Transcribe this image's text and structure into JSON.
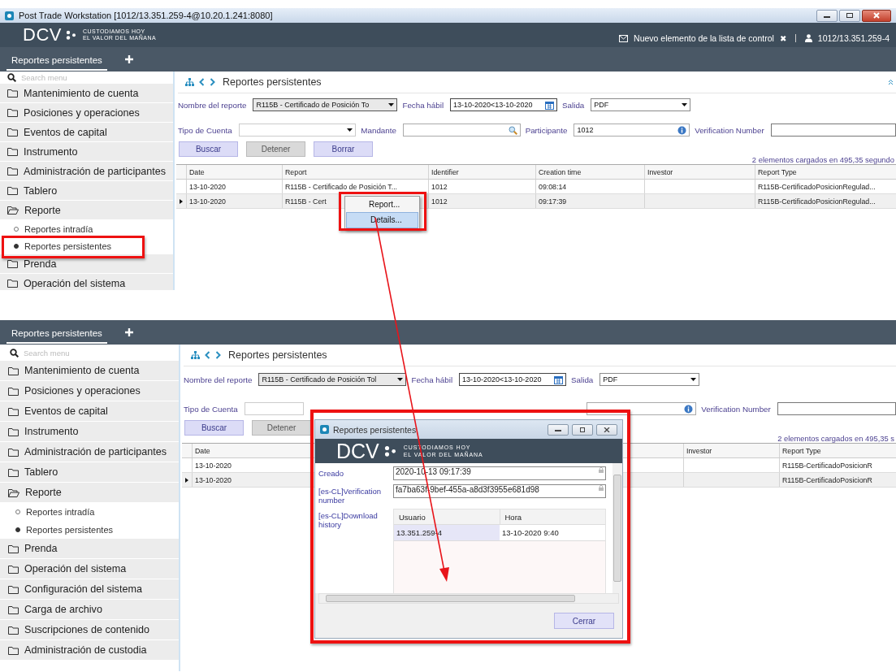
{
  "window": {
    "title": "Post Trade Workstation [1012/13.351.259-4@10.20.1.241:8080]"
  },
  "header": {
    "logo": {
      "mark": "DCV",
      "tagline": [
        "CUSTODIAMOS HOY",
        "EL VALOR DEL MAÑANA"
      ]
    },
    "notification": "Nuevo elemento de la lista de control",
    "dismiss": "✖",
    "user": "1012/13.351.259-4"
  },
  "views": [
    {
      "tabs": [
        {
          "label": "Reportes persistentes",
          "selected": true
        }
      ],
      "sidebar": {
        "search_placeholder": "Search menu",
        "items": [
          {
            "label": "Mantenimiento de cuenta",
            "expanded": false
          },
          {
            "label": "Posiciones y operaciones",
            "expanded": false
          },
          {
            "label": "Eventos de capital",
            "expanded": false
          },
          {
            "label": "Instrumento",
            "expanded": false
          },
          {
            "label": "Administración de participantes",
            "expanded": false
          },
          {
            "label": "Tablero",
            "expanded": false
          },
          {
            "label": "Reporte",
            "expanded": true,
            "children": [
              {
                "label": "Reportes intradía",
                "selected": false
              },
              {
                "label": "Reportes persistentes",
                "selected": true
              }
            ]
          },
          {
            "label": "Prenda",
            "expanded": false
          },
          {
            "label": "Operación del sistema",
            "expanded": false
          }
        ]
      },
      "main": {
        "title": "Reportes persistentes",
        "row1": [
          {
            "kind": "label",
            "text": "Nombre del reporte"
          },
          {
            "kind": "select",
            "value": "R115B - Certificado de Posición To"
          },
          {
            "kind": "label",
            "text": "Fecha hábil"
          },
          {
            "kind": "date",
            "value": "13-10-2020<13-10-2020"
          },
          {
            "kind": "label",
            "text": "Salida"
          },
          {
            "kind": "select",
            "value": "PDF"
          }
        ],
        "row2": [
          {
            "kind": "label",
            "text": "Tipo de Cuenta"
          },
          {
            "kind": "select"
          },
          {
            "kind": "label",
            "text": "Mandante"
          },
          {
            "kind": "search"
          },
          {
            "kind": "label",
            "text": "Participante"
          },
          {
            "kind": "info",
            "value": "1012"
          },
          {
            "kind": "label",
            "text": "Verification Number"
          },
          {
            "kind": "text"
          }
        ],
        "buttons": [
          {
            "label": "Buscar",
            "disabled": false
          },
          {
            "label": "Detener",
            "disabled": true
          },
          {
            "label": "Borrar",
            "disabled": false
          }
        ],
        "status": "2 elementos cargados en 495,35 segundo",
        "table": {
          "columns": [
            "Date",
            "Report",
            "Identifier",
            "Creation time",
            "Investor",
            "Report Type"
          ],
          "rows": [
            {
              "current": false,
              "cells": [
                "13-10-2020",
                "R115B - Certificado de Posición T...",
                "1012",
                "09:08:14",
                null,
                "R115B-CertificadoPosicionRegulad..."
              ]
            },
            {
              "current": true,
              "cells": [
                "13-10-2020",
                "R115B - Cert",
                "1012",
                "09:17:39",
                null,
                "R115B-CertificadoPosicionRegulad..."
              ]
            }
          ]
        }
      }
    },
    {
      "tabs": [
        {
          "label": "Reportes persistentes",
          "selected": true
        }
      ],
      "sidebar": {
        "search_placeholder": "Search menu",
        "items": [
          {
            "label": "Mantenimiento de cuenta",
            "expanded": false
          },
          {
            "label": "Posiciones y operaciones",
            "expanded": false
          },
          {
            "label": "Eventos de capital",
            "expanded": false
          },
          {
            "label": "Instrumento",
            "expanded": false
          },
          {
            "label": "Administración de participantes",
            "expanded": false
          },
          {
            "label": "Tablero",
            "expanded": false
          },
          {
            "label": "Reporte",
            "expanded": true,
            "children": [
              {
                "label": "Reportes intradía",
                "selected": false
              },
              {
                "label": "Reportes persistentes",
                "selected": true
              }
            ]
          },
          {
            "label": "Prenda",
            "expanded": false
          },
          {
            "label": "Operación del sistema",
            "expanded": false
          },
          {
            "label": "Configuración del sistema",
            "expanded": false
          },
          {
            "label": "Carga de archivo",
            "expanded": false
          },
          {
            "label": "Suscripciones de contenido",
            "expanded": false
          },
          {
            "label": "Administración de custodia",
            "expanded": false
          }
        ]
      },
      "main": {
        "title": "Reportes persistentes",
        "row1": [
          {
            "kind": "label",
            "text": "Nombre del reporte"
          },
          {
            "kind": "select",
            "value": "R115B - Certificado de Posición Tol"
          },
          {
            "kind": "label",
            "text": "Fecha hábil"
          },
          {
            "kind": "date",
            "value": "13-10-2020<13-10-2020"
          },
          {
            "kind": "label",
            "text": "Salida"
          },
          {
            "kind": "select",
            "value": "PDF"
          }
        ],
        "row2": [
          {
            "kind": "label",
            "text": "Tipo de Cuenta"
          },
          {
            "kind": "text"
          },
          {
            "kind": "info"
          },
          {
            "kind": "label",
            "text": "Verification Number"
          },
          {
            "kind": "text"
          }
        ],
        "buttons": [
          {
            "label": "Buscar",
            "disabled": false
          },
          {
            "label": "Detener",
            "disabled": true
          }
        ],
        "status": "2 elementos cargados en 495,35 s",
        "table": {
          "columns": [
            "Date",
            "Investor",
            "Report Type"
          ],
          "rows": [
            {
              "current": false,
              "cells": [
                "13-10-2020",
                null,
                "R115B-CertificadoPosicionR"
              ]
            },
            {
              "current": true,
              "cells": [
                "13-10-2020",
                null,
                "R115B-CertificadoPosicionR"
              ]
            }
          ]
        }
      }
    }
  ],
  "context_menu": {
    "items": [
      {
        "label": "Report...",
        "selected": false
      },
      {
        "label": "Details...",
        "selected": true
      }
    ]
  },
  "dialog": {
    "title": "Reportes persistentes",
    "logo": {
      "mark": "DCV",
      "tagline": [
        "CUSTODIAMOS HOY",
        "EL VALOR DEL MAÑANA"
      ]
    },
    "fields": [
      {
        "label": "Creado",
        "value": "2020-10-13 09:17:39"
      },
      {
        "label": "[es-CL]Verification number",
        "value": "fa7ba63f-9bef-455a-a8d3f3955e681d98"
      }
    ],
    "history": {
      "label": "[es-CL]Download history",
      "columns": [
        "Usuario",
        "Hora"
      ],
      "rows": [
        [
          "13.351.259-4",
          "13-10-2020 9:40"
        ]
      ]
    },
    "button": "Cerrar"
  }
}
